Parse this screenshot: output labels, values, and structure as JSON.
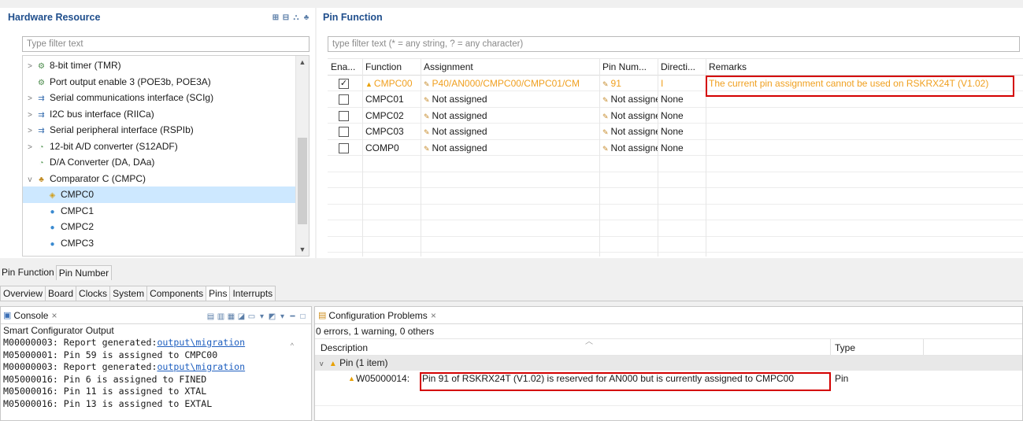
{
  "hw": {
    "title": "Hardware Resource",
    "filter_placeholder": "Type filter text",
    "toolbar_icons": [
      "expand-all-icon",
      "collapse-all-icon",
      "tree-icon",
      "hierarchy-icon"
    ],
    "items": [
      {
        "label": "8-bit timer (TMR)",
        "twisty": ">",
        "icon": "timer-icon",
        "level": 0
      },
      {
        "label": "Port output enable 3 (POE3b, POE3A)",
        "twisty": "",
        "icon": "timer-icon",
        "level": 0
      },
      {
        "label": "Serial communications interface (SCIg)",
        "twisty": ">",
        "icon": "serial-icon",
        "level": 0
      },
      {
        "label": "I2C bus interface (RIICa)",
        "twisty": ">",
        "icon": "serial-icon",
        "level": 0
      },
      {
        "label": "Serial peripheral interface (RSPIb)",
        "twisty": ">",
        "icon": "serial-icon",
        "level": 0
      },
      {
        "label": "12-bit A/D converter (S12ADF)",
        "twisty": ">",
        "icon": "adc-icon",
        "level": 0
      },
      {
        "label": "D/A Converter (DA, DAa)",
        "twisty": "",
        "icon": "adc-icon",
        "level": 0
      },
      {
        "label": "Comparator C (CMPC)",
        "twisty": "v",
        "icon": "comparator-icon",
        "level": 0
      },
      {
        "label": "CMPC0",
        "twisty": "",
        "icon": "channel-warn-icon",
        "level": 1,
        "selected": true
      },
      {
        "label": "CMPC1",
        "twisty": "",
        "icon": "channel-icon",
        "level": 1
      },
      {
        "label": "CMPC2",
        "twisty": "",
        "icon": "channel-icon",
        "level": 1
      },
      {
        "label": "CMPC3",
        "twisty": "",
        "icon": "channel-icon",
        "level": 1
      }
    ]
  },
  "pf": {
    "title": "Pin Function",
    "filter_placeholder": "type filter text (* = any string, ? = any character)",
    "columns": [
      "Ena...",
      "Function",
      "Assignment",
      "Pin Num...",
      "Directi...",
      "Remarks"
    ],
    "rows": [
      {
        "enabled": true,
        "function": "CMPC00",
        "assignment": "P40/AN000/CMPC00/CMPC01/CM",
        "pin": "91",
        "direction": "I",
        "remarks": "The current pin assignment cannot be used on RSKRX24T (V1.02)",
        "warn": true
      },
      {
        "enabled": false,
        "function": "CMPC01",
        "assignment": "Not assigned",
        "pin": "Not assigned",
        "direction": "None",
        "remarks": "",
        "warn": false
      },
      {
        "enabled": false,
        "function": "CMPC02",
        "assignment": "Not assigned",
        "pin": "Not assigned",
        "direction": "None",
        "remarks": "",
        "warn": false
      },
      {
        "enabled": false,
        "function": "CMPC03",
        "assignment": "Not assigned",
        "pin": "Not assigned",
        "direction": "None",
        "remarks": "",
        "warn": false
      },
      {
        "enabled": false,
        "function": "COMP0",
        "assignment": "Not assigned",
        "pin": "Not assigned",
        "direction": "None",
        "remarks": "",
        "warn": false
      }
    ]
  },
  "view_tabs": [
    "Pin Function",
    "Pin Number"
  ],
  "editor_tabs": [
    "Overview",
    "Board",
    "Clocks",
    "System",
    "Components",
    "Pins",
    "Interrupts"
  ],
  "active_editor_tab": "Pins",
  "console": {
    "tab": "Console",
    "close": "×",
    "subtitle": "Smart Configurator Output",
    "lines": [
      {
        "text": "M00000003: Report generated:",
        "link": "output\\migration"
      },
      {
        "text": "M05000001: Pin 59 is assigned to CMPC00",
        "link": ""
      },
      {
        "text": "M00000003: Report generated:",
        "link": "output\\migration"
      },
      {
        "text": "M05000016: Pin 6 is assigned to FINED",
        "link": ""
      },
      {
        "text": "M05000016: Pin 11 is assigned to XTAL",
        "link": ""
      },
      {
        "text": "M05000016: Pin 13 is assigned to EXTAL",
        "link": ""
      }
    ]
  },
  "problems": {
    "tab": "Configuration Problems",
    "close": "×",
    "summary": "0 errors, 1 warning, 0 others",
    "col_description": "Description",
    "col_type": "Type",
    "group": "Pin (1 item)",
    "item_id": "W05000014:",
    "item_text": "Pin 91 of RSKRX24T (V1.02) is reserved for AN000 but is currently assigned to CMPC00",
    "item_type": "Pin"
  },
  "colors": {
    "accent": "#1f4e8c",
    "warning": "#f0a020",
    "highlight": "#d40000",
    "selection": "#cde8ff"
  }
}
